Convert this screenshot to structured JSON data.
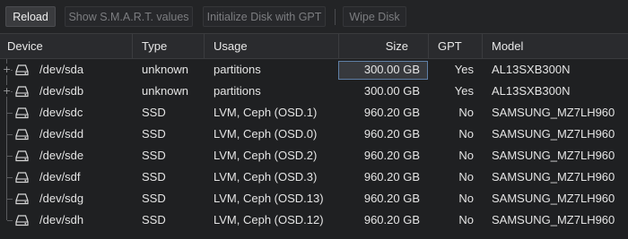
{
  "toolbar": {
    "reload": "Reload",
    "smart": "Show S.M.A.R.T. values",
    "init_gpt": "Initialize Disk with GPT",
    "wipe": "Wipe Disk"
  },
  "columns": {
    "device": "Device",
    "type": "Type",
    "usage": "Usage",
    "size": "Size",
    "gpt": "GPT",
    "model": "Model"
  },
  "rows": [
    {
      "device": "/dev/sda",
      "type": "unknown",
      "usage": "partitions",
      "size": "300.00 GB",
      "gpt": "Yes",
      "model": "AL13SXB300N",
      "expandable": true,
      "selected": true
    },
    {
      "device": "/dev/sdb",
      "type": "unknown",
      "usage": "partitions",
      "size": "300.00 GB",
      "gpt": "Yes",
      "model": "AL13SXB300N",
      "expandable": true,
      "selected": false
    },
    {
      "device": "/dev/sdc",
      "type": "SSD",
      "usage": "LVM, Ceph (OSD.1)",
      "size": "960.20 GB",
      "gpt": "No",
      "model": "SAMSUNG_MZ7LH960",
      "expandable": false,
      "selected": false
    },
    {
      "device": "/dev/sdd",
      "type": "SSD",
      "usage": "LVM, Ceph (OSD.0)",
      "size": "960.20 GB",
      "gpt": "No",
      "model": "SAMSUNG_MZ7LH960",
      "expandable": false,
      "selected": false
    },
    {
      "device": "/dev/sde",
      "type": "SSD",
      "usage": "LVM, Ceph (OSD.2)",
      "size": "960.20 GB",
      "gpt": "No",
      "model": "SAMSUNG_MZ7LH960",
      "expandable": false,
      "selected": false
    },
    {
      "device": "/dev/sdf",
      "type": "SSD",
      "usage": "LVM, Ceph (OSD.3)",
      "size": "960.20 GB",
      "gpt": "No",
      "model": "SAMSUNG_MZ7LH960",
      "expandable": false,
      "selected": false
    },
    {
      "device": "/dev/sdg",
      "type": "SSD",
      "usage": "LVM, Ceph (OSD.13)",
      "size": "960.20 GB",
      "gpt": "No",
      "model": "SAMSUNG_MZ7LH960",
      "expandable": false,
      "selected": false
    },
    {
      "device": "/dev/sdh",
      "type": "SSD",
      "usage": "LVM, Ceph (OSD.12)",
      "size": "960.20 GB",
      "gpt": "No",
      "model": "SAMSUNG_MZ7LH960",
      "expandable": false,
      "selected": false
    }
  ],
  "icons": {
    "row_icon": "hard-disk-icon",
    "expand_icon": "plus-icon"
  },
  "colors": {
    "background": "#1f2022",
    "selection_border": "#5f7fa6"
  }
}
